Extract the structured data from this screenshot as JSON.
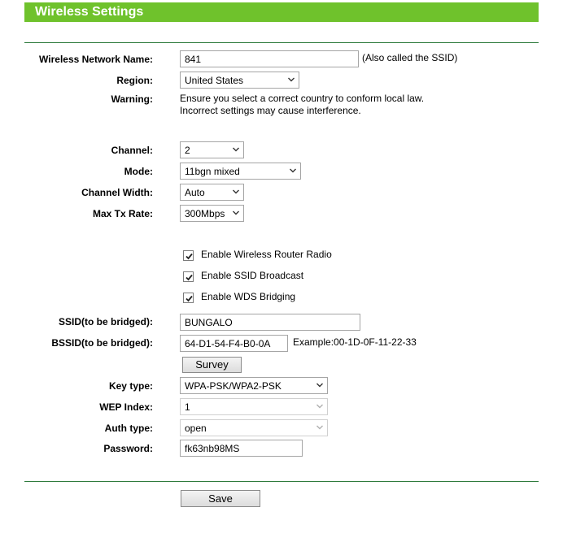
{
  "title": "Wireless Settings",
  "ssid": {
    "label": "Wireless Network Name:",
    "value": "841",
    "note": "(Also called the SSID)"
  },
  "region": {
    "label": "Region:",
    "value": "United States"
  },
  "warning": {
    "label": "Warning:",
    "line1": "Ensure you select a correct country to conform local law.",
    "line2": "Incorrect settings may cause interference."
  },
  "channel": {
    "label": "Channel:",
    "value": "2"
  },
  "mode": {
    "label": "Mode:",
    "value": "11bgn mixed"
  },
  "channel_width": {
    "label": "Channel Width:",
    "value": "Auto"
  },
  "max_tx_rate": {
    "label": "Max Tx Rate:",
    "value": "300Mbps"
  },
  "checkboxes": [
    {
      "label": "Enable Wireless Router Radio",
      "checked": true
    },
    {
      "label": "Enable SSID Broadcast",
      "checked": true
    },
    {
      "label": "Enable WDS Bridging",
      "checked": true
    }
  ],
  "ssid_bridged": {
    "label": "SSID(to be bridged):",
    "value": "BUNGALO"
  },
  "bssid_bridged": {
    "label": "BSSID(to be bridged):",
    "value": "64-D1-54-F4-B0-0A",
    "example": "Example:00-1D-0F-11-22-33"
  },
  "survey_button": "Survey",
  "key_type": {
    "label": "Key type:",
    "value": "WPA-PSK/WPA2-PSK"
  },
  "wep_index": {
    "label": "WEP Index:",
    "value": "1"
  },
  "auth_type": {
    "label": "Auth type:",
    "value": "open"
  },
  "password": {
    "label": "Password:",
    "value": "fk63nb98MS"
  },
  "save_button": "Save",
  "colors": {
    "header_green": "#6fc22c",
    "divider_green": "#2e7a3c"
  },
  "icons": {
    "dropdown": "chevron-down-icon",
    "checkbox": "checkmark-icon"
  }
}
